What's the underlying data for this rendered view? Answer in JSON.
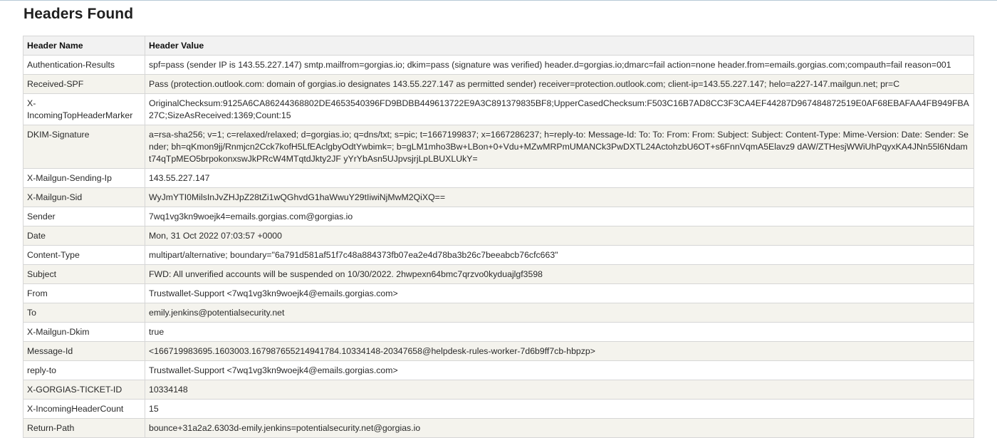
{
  "page": {
    "title": "Headers Found"
  },
  "table": {
    "columns": [
      "Header Name",
      "Header Value"
    ],
    "rows": [
      {
        "name": "Authentication-Results",
        "value": "spf=pass (sender IP is 143.55.227.147) smtp.mailfrom=gorgias.io; dkim=pass (signature was verified) header.d=gorgias.io;dmarc=fail action=none header.from=emails.gorgias.com;compauth=fail reason=001"
      },
      {
        "name": "Received-SPF",
        "value": "Pass (protection.outlook.com: domain of gorgias.io designates 143.55.227.147 as permitted sender) receiver=protection.outlook.com; client-ip=143.55.227.147; helo=a227-147.mailgun.net; pr=C"
      },
      {
        "name": "X-IncomingTopHeaderMarker",
        "value": "OriginalChecksum:9125A6CA86244368802DE4653540396FD9BDBB449613722E9A3C891379835BF8;UpperCasedChecksum:F503C16B7AD8CC3F3CA4EF44287D967484872519E0AF68EBAFAA4FB949FBA27C;SizeAsReceived:1369;Count:15"
      },
      {
        "name": "DKIM-Signature",
        "value": "a=rsa-sha256; v=1; c=relaxed/relaxed; d=gorgias.io; q=dns/txt; s=pic; t=1667199837; x=1667286237; h=reply-to: Message-Id: To: To: From: From: Subject: Subject: Content-Type: Mime-Version: Date: Sender: Sender; bh=qKmon9jj/Rnmjcn2Cck7kofH5LfEAclgbyOdtYwbimk=; b=gLM1mho3Bw+LBon+0+Vdu+MZwMRPmUMANCk3PwDXTL24ActohzbU6OT+s6FnnVqmA5Elavz9 dAW/ZTHesjWWiUhPqyxKA4JNn55l6Ndamt74qTpMEO5brpokonxswJkPRcW4MTqtdJkty2JF yYrYbAsn5UJpvsjrjLpLBUXLUkY="
      },
      {
        "name": "X-Mailgun-Sending-Ip",
        "value": "143.55.227.147"
      },
      {
        "name": "X-Mailgun-Sid",
        "value": "WyJmYTI0MilsInJvZHJpZ28tZi1wQGhvdG1haWwuY29tIiwiNjMwM2QiXQ=="
      },
      {
        "name": "Sender",
        "value": "7wq1vg3kn9woejk4=emails.gorgias.com@gorgias.io"
      },
      {
        "name": "Date",
        "value": "Mon, 31 Oct 2022 07:03:57 +0000"
      },
      {
        "name": "Content-Type",
        "value": "multipart/alternative; boundary=\"6a791d581af51f7c48a884373fb07ea2e4d78ba3b26c7beeabcb76cfc663\""
      },
      {
        "name": "Subject",
        "value": "FWD: All unverified accounts will be suspended on 10/30/2022. 2hwpexn64bmc7qrzvo0kyduajlgf3598"
      },
      {
        "name": "From",
        "value": "Trustwallet-Support <7wq1vg3kn9woejk4@emails.gorgias.com>"
      },
      {
        "name": "To",
        "value": "emily.jenkins@potentialsecurity.net"
      },
      {
        "name": "X-Mailgun-Dkim",
        "value": "true"
      },
      {
        "name": "Message-Id",
        "value": "<166719983695.1603003.167987655214941784.10334148-20347658@helpdesk-rules-worker-7d6b9ff7cb-hbpzp>"
      },
      {
        "name": "reply-to",
        "value": "Trustwallet-Support <7wq1vg3kn9woejk4@emails.gorgias.com>"
      },
      {
        "name": "X-GORGIAS-TICKET-ID",
        "value": "10334148"
      },
      {
        "name": "X-IncomingHeaderCount",
        "value": "15"
      },
      {
        "name": "Return-Path",
        "value": "bounce+31a2a2.6303d-emily.jenkins=potentialsecurity.net@gorgias.io"
      }
    ]
  }
}
